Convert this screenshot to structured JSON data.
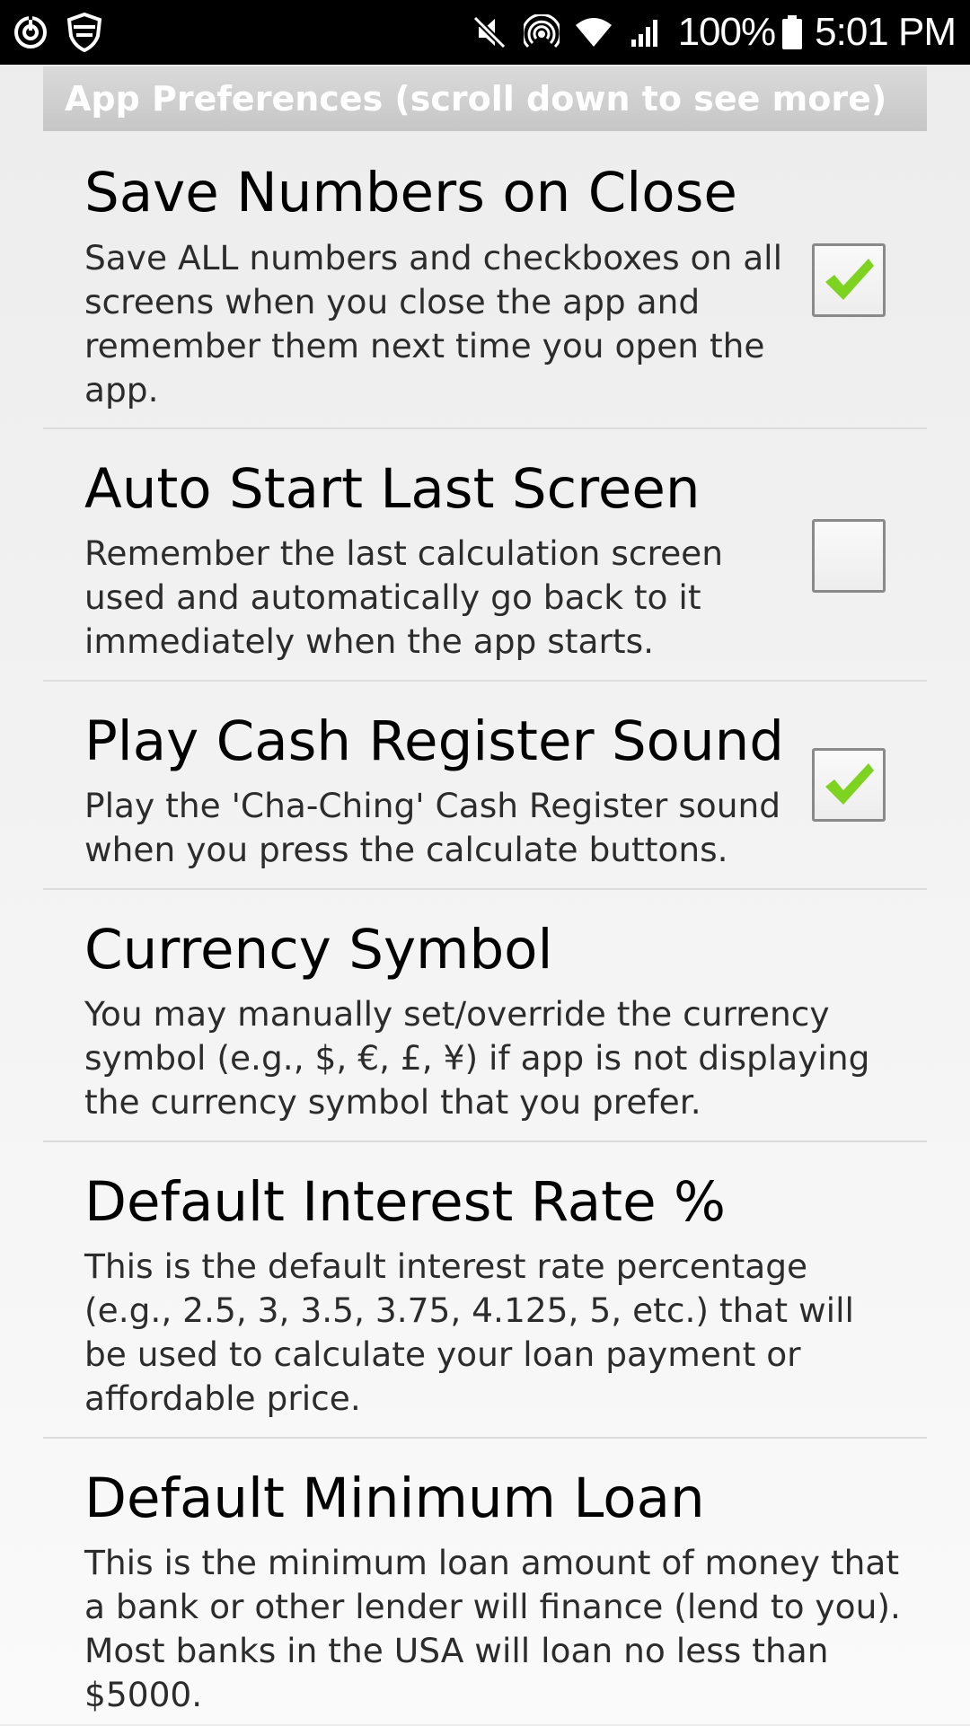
{
  "status_bar": {
    "left_icons": [
      "sync-icon",
      "shield-icon"
    ],
    "right_icons": [
      "mute-icon",
      "hotspot-icon",
      "wifi-icon",
      "signal-icon"
    ],
    "battery": "100%",
    "time": "5:01 PM"
  },
  "header": {
    "title": "App Preferences (scroll down to see more)"
  },
  "preferences": [
    {
      "title": "Save Numbers on Close",
      "description": "Save ALL numbers and checkboxes on all screens when you close the app and remember them next time you open the app.",
      "checked": true
    },
    {
      "title": "Auto Start Last Screen",
      "description": "Remember the last calculation screen used and automatically go back to it immediately when the app starts.",
      "checked": false
    },
    {
      "title": "Play Cash Register Sound",
      "description": "Play the 'Cha-Ching' Cash Register sound when you press the calculate buttons.",
      "checked": true
    },
    {
      "title": "Currency Symbol",
      "description": "You may manually set/override the currency symbol (e.g., $, €, £, ¥) if app is not displaying the currency symbol that you prefer."
    },
    {
      "title": "Default Interest Rate %",
      "description": "This is the default interest rate percentage (e.g., 2.5, 3, 3.5, 3.75, 4.125, 5, etc.) that will be used to calculate your loan payment or affordable price."
    },
    {
      "title": "Default Minimum Loan",
      "description": "This is the minimum loan amount of money that a bank or other lender will finance (lend to you). Most banks in the USA will loan no less than $5000."
    }
  ],
  "colors": {
    "checkmark": "#7ed321",
    "header_bg": "#c8c8c8"
  }
}
